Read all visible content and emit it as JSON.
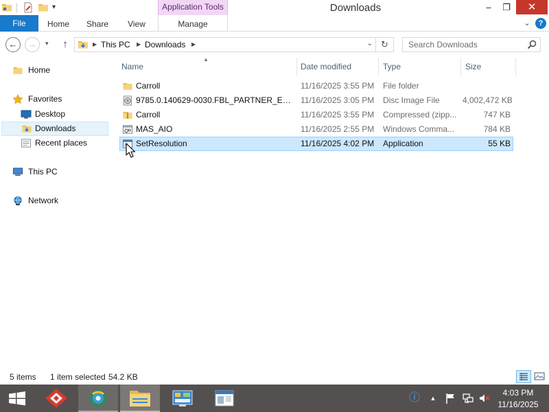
{
  "window": {
    "title": "Downloads",
    "context_group": "Application Tools",
    "minimize": "–",
    "maximize": "❐",
    "close": "✕"
  },
  "qat": {
    "dropdown": "▾"
  },
  "ribbon": {
    "tabs": {
      "file": "File",
      "home": "Home",
      "share": "Share",
      "view": "View",
      "manage": "Manage"
    },
    "expand": "⌄",
    "help": "?"
  },
  "navigation": {
    "back": "←",
    "forward": "→",
    "recent": "▾",
    "up": "↑",
    "breadcrumb": [
      "This PC",
      "Downloads"
    ],
    "crumb_separator": "▶",
    "address_dropdown": "⌄",
    "refresh": "↻",
    "search_placeholder": "Search Downloads"
  },
  "nav_pane": {
    "home": "Home",
    "favorites": "Favorites",
    "desktop": "Desktop",
    "downloads": "Downloads",
    "recent_places": "Recent places",
    "this_pc": "This PC",
    "network": "Network"
  },
  "file_list": {
    "columns": [
      "Name",
      "Date modified",
      "Type",
      "Size"
    ],
    "sort_indicator": "▲",
    "rows": [
      {
        "name": "Carroll",
        "date": "11/16/2025 3:55 PM",
        "type": "File folder",
        "size": "",
        "icon": "folder-icon"
      },
      {
        "name": "9785.0.140629-0030.FBL_PARTNER_EEAP_...",
        "date": "11/16/2025 3:05 PM",
        "type": "Disc Image File",
        "size": "4,002,472 KB",
        "icon": "disc-image-icon"
      },
      {
        "name": "Carroll",
        "date": "11/16/2025 3:55 PM",
        "type": "Compressed (zipp...",
        "size": "747 KB",
        "icon": "zip-folder-icon"
      },
      {
        "name": "MAS_AIO",
        "date": "11/16/2025 2:55 PM",
        "type": "Windows Comma...",
        "size": "784 KB",
        "icon": "cmd-script-icon"
      },
      {
        "name": "SetResolution",
        "date": "11/16/2025 4:02 PM",
        "type": "Application",
        "size": "55 KB",
        "icon": "application-icon",
        "selected": true
      }
    ]
  },
  "status": {
    "count": "5 items",
    "selected": "1 item selected",
    "size": "54.2 KB"
  },
  "taskbar": {
    "tray_up": "▲",
    "tray_info": "ⓘ",
    "time": "4:03 PM",
    "date": "11/16/2025"
  },
  "colors": {
    "file_tab": "#1979ca",
    "context_tab": "#f2d7f5",
    "selection": "#cce8ff",
    "close_button": "#c7362b",
    "taskbar": "#545050"
  }
}
